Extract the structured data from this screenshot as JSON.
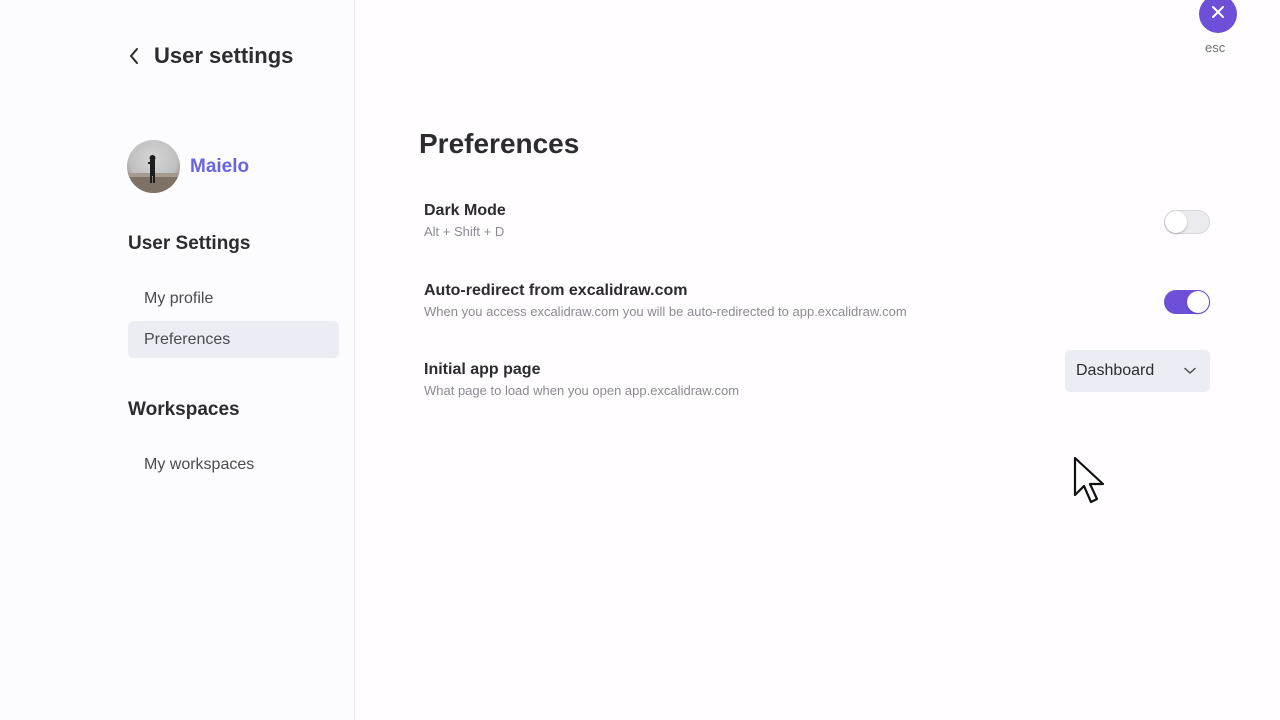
{
  "sidebar": {
    "title": "User settings",
    "profile_name": "Maielo",
    "user_settings_heading": "User Settings",
    "user_settings_items": [
      {
        "label": "My profile",
        "active": false
      },
      {
        "label": "Preferences",
        "active": true
      }
    ],
    "workspaces_heading": "Workspaces",
    "workspaces_items": [
      {
        "label": "My workspaces",
        "active": false
      }
    ]
  },
  "header": {
    "close_icon": "close-icon",
    "esc_label": "esc"
  },
  "main": {
    "title": "Preferences",
    "settings": [
      {
        "label": "Dark Mode",
        "description": "Alt + Shift + D",
        "control": "toggle",
        "enabled": false
      },
      {
        "label": "Auto-redirect from excalidraw.com",
        "description": "When you access excalidraw.com you will be auto-redirected to app.excalidraw.com",
        "control": "toggle",
        "enabled": true
      },
      {
        "label": "Initial app page",
        "description": "What page to load when you open app.excalidraw.com",
        "control": "select",
        "selected": "Dashboard"
      }
    ]
  },
  "colors": {
    "accent": "#6e4fd8",
    "profile_name": "#6965db",
    "active_nav_bg": "#ececf4"
  }
}
